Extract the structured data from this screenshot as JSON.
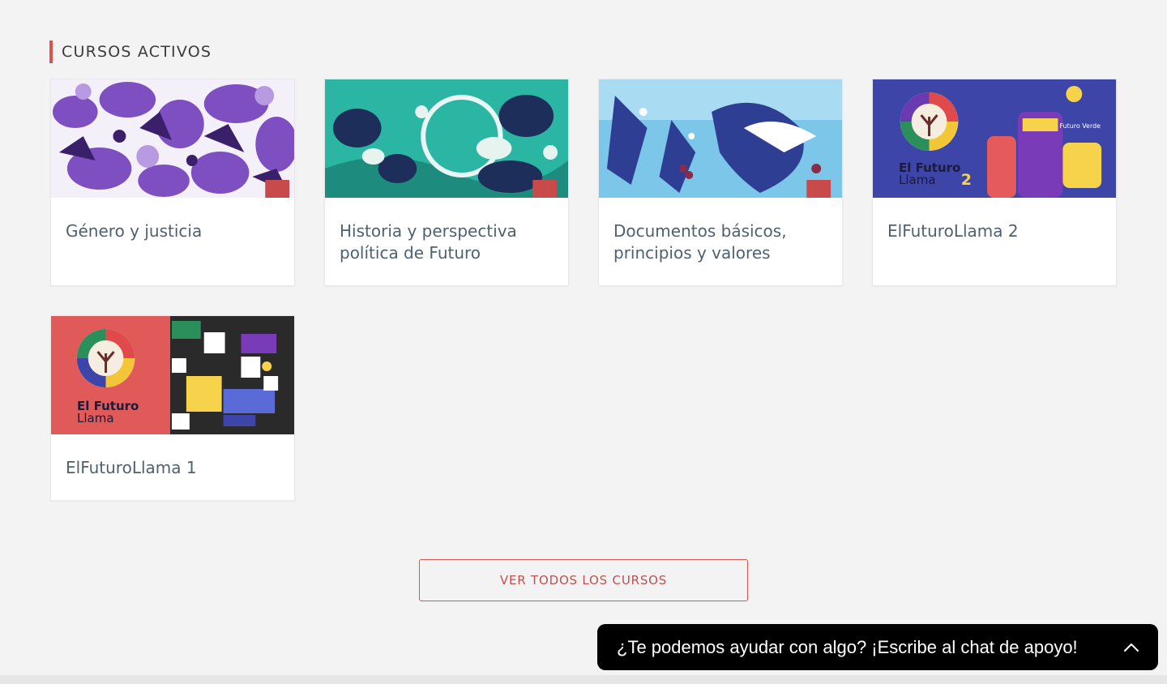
{
  "section": {
    "title": "CURSOS ACTIVOS",
    "accent_color": "#d9534f"
  },
  "courses": [
    {
      "title": "Género y justicia",
      "image_icon": "purple-floral-illustration"
    },
    {
      "title": "Historia y perspectiva política de Futuro",
      "image_icon": "teal-landscape-illustration"
    },
    {
      "title": "Documentos básicos, principios y valores",
      "image_icon": "blue-birds-illustration"
    },
    {
      "title": "ElFuturoLlama 2",
      "image_icon": "el-futuro-llama-2-cover",
      "image_text": {
        "brand_line1": "El Futuro",
        "brand_line2": "Llama",
        "number": "2"
      }
    },
    {
      "title": "ElFuturoLlama 1",
      "image_icon": "el-futuro-llama-1-cover",
      "image_text": {
        "brand_line1": "El Futuro",
        "brand_line2": "Llama"
      }
    }
  ],
  "cta": {
    "label": "VER TODOS LOS CURSOS"
  },
  "chat": {
    "label": "¿Te podemos ayudar con algo? ¡Escribe al chat de apoyo!",
    "icon": "chevron-up-icon"
  }
}
